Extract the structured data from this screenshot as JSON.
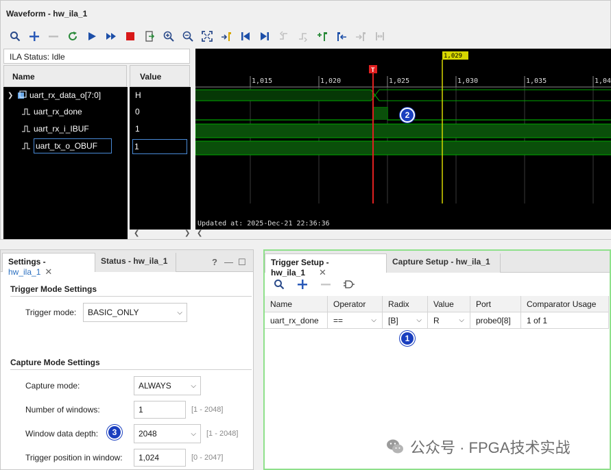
{
  "waveform": {
    "title": "Waveform - hw_ila_1",
    "ila_status": "ILA Status: Idle",
    "name_header": "Name",
    "value_header": "Value",
    "signals": [
      {
        "name": "uart_rx_data_o[7:0]",
        "value": "H"
      },
      {
        "name": "uart_rx_done",
        "value": "0"
      },
      {
        "name": "uart_rx_i_IBUF",
        "value": "1"
      },
      {
        "name": "uart_tx_o_OBUF",
        "value": "1"
      }
    ],
    "time_ticks": [
      "1,015",
      "1,020",
      "1,025",
      "1,030",
      "1,035",
      "1,04"
    ],
    "cursor_label": "1,029",
    "trigger_marker": "T",
    "updated_text": "Updated at: 2025-Dec-21 22:36:36",
    "toolbar_icons": [
      "search-icon",
      "add-icon",
      "remove-icon",
      "refresh-icon",
      "run-trigger-icon",
      "run-immediate-icon",
      "stop-icon",
      "export-icon",
      "zoom-in-icon",
      "zoom-out-icon",
      "zoom-fit-icon",
      "go-to-cursor-icon",
      "go-to-start-icon",
      "go-to-end-icon",
      "previous-transition-icon",
      "next-transition-icon",
      "add-marker-icon",
      "previous-marker-icon",
      "next-marker-icon",
      "swap-cursors-icon"
    ],
    "colors": {
      "wave": "#00a800",
      "bus_fill": "#0a4f0a",
      "trigger": "#e02020",
      "cursor": "#d8d800",
      "background": "#000000"
    }
  },
  "settings": {
    "tab_active_prefix": "Settings - ",
    "tab_active_link": "hw_ila_1",
    "tab_inactive": "Status - hw_ila_1",
    "help": "?",
    "trigger_mode_section": "Trigger Mode Settings",
    "trigger_mode_label": "Trigger mode:",
    "trigger_mode_value": "BASIC_ONLY",
    "capture_mode_section": "Capture Mode Settings",
    "capture_mode_label": "Capture mode:",
    "capture_mode_value": "ALWAYS",
    "num_windows_label": "Number of windows:",
    "num_windows_value": "1",
    "num_windows_range": "[1 - 2048]",
    "window_depth_label": "Window data depth:",
    "window_depth_value": "2048",
    "window_depth_range": "[1 - 2048]",
    "trigger_pos_label": "Trigger position in window:",
    "trigger_pos_value": "1,024",
    "trigger_pos_range": "[0 - 2047]"
  },
  "trigger_setup": {
    "tab_active": "Trigger Setup - hw_ila_1",
    "tab_inactive": "Capture Setup - hw_ila_1",
    "columns": [
      "Name",
      "Operator",
      "Radix",
      "Value",
      "Port",
      "Comparator Usage"
    ],
    "row": {
      "name": "uart_rx_done",
      "operator": "==",
      "radix": "[B]",
      "value": "R",
      "port": "probe0[8]",
      "usage": "1 of 1"
    }
  },
  "badges": {
    "one": "1",
    "two": "2",
    "three": "3"
  },
  "watermark": "公众号 · FPGA技术实战"
}
